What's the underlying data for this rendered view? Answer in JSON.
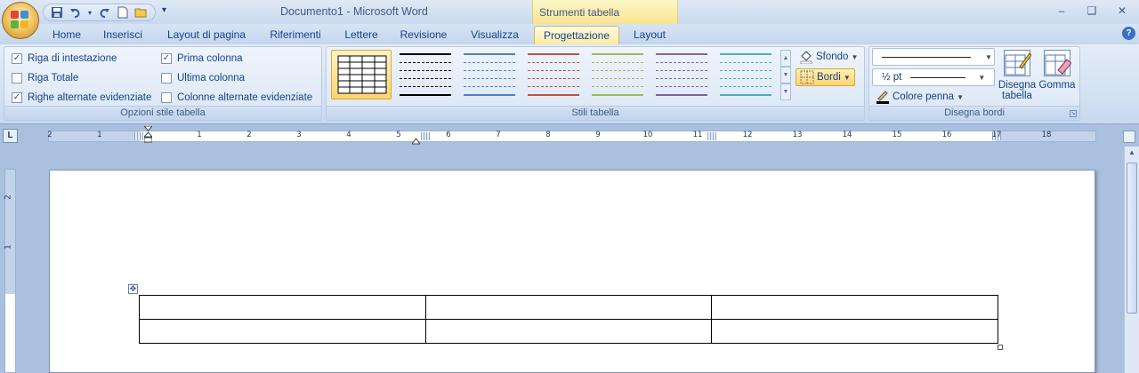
{
  "window": {
    "title": "Documento1 - Microsoft Word",
    "context_tab_group": "Strumenti tabella",
    "controls": [
      "minimize",
      "restore",
      "close"
    ]
  },
  "quick_access": {
    "items": [
      "save-icon",
      "undo-icon",
      "redo-icon",
      "new-icon",
      "open-icon"
    ],
    "customize_symbol": "▾"
  },
  "ribbon": {
    "tabs": [
      {
        "label": "Home"
      },
      {
        "label": "Inserisci"
      },
      {
        "label": "Layout di pagina"
      },
      {
        "label": "Riferimenti"
      },
      {
        "label": "Lettere"
      },
      {
        "label": "Revisione"
      },
      {
        "label": "Visualizza"
      },
      {
        "label": "Progettazione",
        "active": true
      },
      {
        "label": "Layout"
      }
    ],
    "groups": {
      "table_style_options": {
        "label": "Opzioni stile tabella",
        "options": [
          {
            "label": "Riga di intestazione",
            "checked": true
          },
          {
            "label": "Riga Totale",
            "checked": false
          },
          {
            "label": "Righe alternate evidenziate",
            "checked": true
          },
          {
            "label": "Prima colonna",
            "checked": true
          },
          {
            "label": "Ultima colonna",
            "checked": false
          },
          {
            "label": "Colonne alternate evidenziate",
            "checked": false
          }
        ]
      },
      "table_styles": {
        "label": "Stili tabella",
        "style_colors": [
          "#000000",
          "#000000",
          "#4f81bd",
          "#c0504d",
          "#9bbb59",
          "#8064a2",
          "#4bacc6"
        ],
        "shading_label": "Sfondo",
        "borders_label": "Bordi"
      },
      "draw_borders": {
        "label": "Disegna bordi",
        "line_weight": "½ pt",
        "pen_color_label": "Colore penna",
        "draw_table_label": "Disegna tabella",
        "eraser_label": "Gomma"
      }
    }
  },
  "ruler": {
    "corner_symbol": "L",
    "numbers": [
      "2",
      "1",
      "1",
      "2",
      "3",
      "4",
      "5",
      "6",
      "7",
      "8",
      "9",
      "10",
      "11",
      "12",
      "13",
      "14",
      "15",
      "16",
      "17",
      "18"
    ],
    "vertical_numbers": [
      "2",
      "1"
    ]
  },
  "document": {
    "table": {
      "rows": 2,
      "columns": 3,
      "cells": [
        [
          "",
          "",
          ""
        ],
        [
          "",
          "",
          ""
        ]
      ]
    }
  },
  "colors": {
    "ribbon_bg": "#dbe6f5",
    "active_tab": "#fbeaa4",
    "context_tab": "#f8e48f",
    "workspace": "#a9c0df"
  }
}
